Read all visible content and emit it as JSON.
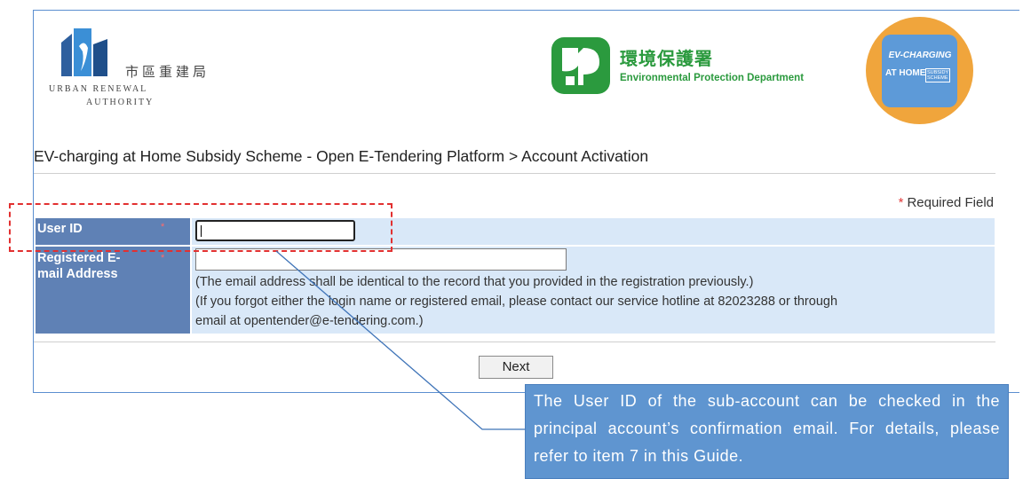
{
  "header": {
    "ura_logo": {
      "name_zh": "市區重建局",
      "name_en_line1": "URBAN RENEWAL",
      "name_en_line2": "AUTHORITY",
      "icon": "ura-logo-icon"
    },
    "epd_logo": {
      "name_zh": "環境保護署",
      "name_en": "Environmental Protection Department",
      "icon": "epd-logo-icon",
      "color": "#2b9a3e"
    },
    "scheme_badge": {
      "line1": "EV-CHARGING",
      "line2": "AT HOME",
      "line3a": "SUBSIDY",
      "line3b": "SCHEME",
      "color": "#f0a53c"
    }
  },
  "breadcrumb": "EV-charging at Home Subsidy Scheme - Open E-Tendering Platform > Account Activation",
  "required_note": "Required Field",
  "form": {
    "user_id": {
      "label": "User ID",
      "value": ""
    },
    "email": {
      "label": "Registered E-mail Address",
      "value": "",
      "note1": "(The email address shall be identical to the record that you provided in the registration previously.)",
      "note2": "(If you forgot either the login name or registered email, please contact our service hotline at 82023288 or through",
      "note3": "email at opentender@e-tendering.com.)"
    },
    "next_label": "Next"
  },
  "annotation": {
    "callout_text": "The User ID of the sub-account can be checked in the principal account’s confirmation email. For details, please refer to item 7 in this Guide.",
    "highlight_color": "#e23030",
    "callout_color": "#5f95d0"
  },
  "colors": {
    "label_bg": "#5f81b5",
    "value_bg": "#d9e8f8",
    "frame": "#5b8fd0"
  }
}
